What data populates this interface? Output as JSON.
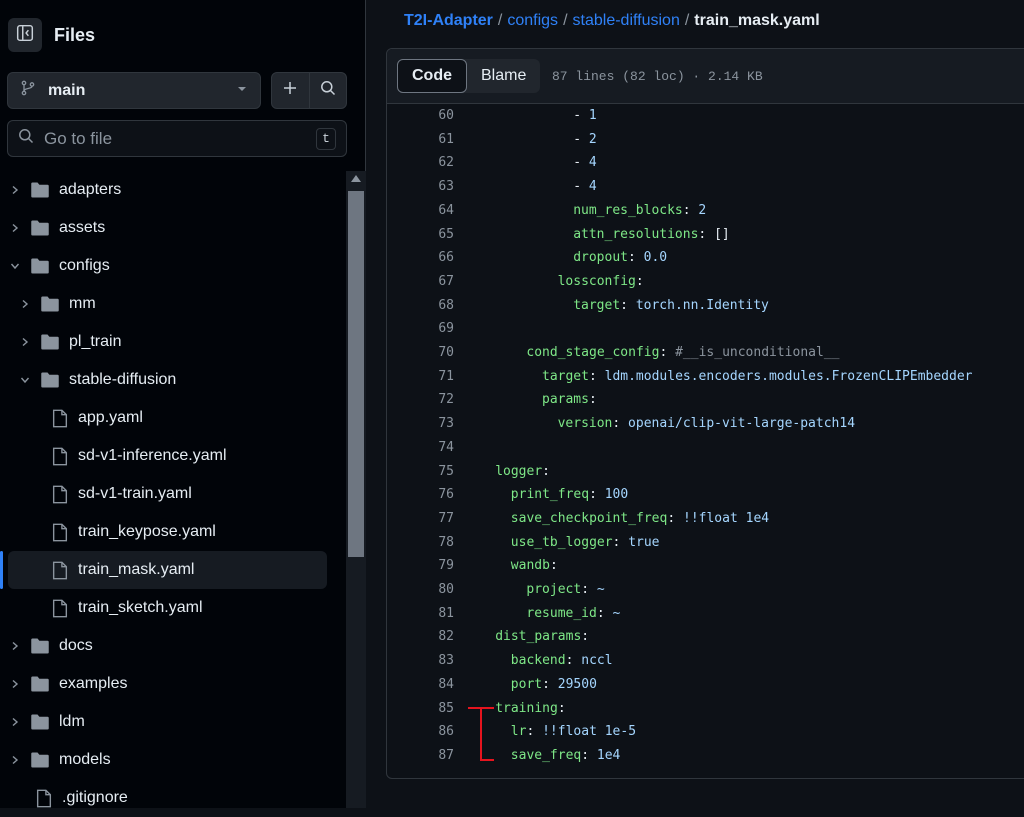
{
  "sidebar": {
    "title": "Files",
    "branch": "main",
    "search_placeholder": "Go to file",
    "search_shortcut": "t",
    "tree": [
      {
        "label": "adapters",
        "type": "folder",
        "depth": 0,
        "expanded": false
      },
      {
        "label": "assets",
        "type": "folder",
        "depth": 0,
        "expanded": false
      },
      {
        "label": "configs",
        "type": "folder",
        "depth": 0,
        "expanded": true
      },
      {
        "label": "mm",
        "type": "folder",
        "depth": 1,
        "expanded": false
      },
      {
        "label": "pl_train",
        "type": "folder",
        "depth": 1,
        "expanded": false
      },
      {
        "label": "stable-diffusion",
        "type": "folder",
        "depth": 1,
        "expanded": true
      },
      {
        "label": "app.yaml",
        "type": "file",
        "depth": 2
      },
      {
        "label": "sd-v1-inference.yaml",
        "type": "file",
        "depth": 2
      },
      {
        "label": "sd-v1-train.yaml",
        "type": "file",
        "depth": 2
      },
      {
        "label": "train_keypose.yaml",
        "type": "file",
        "depth": 2
      },
      {
        "label": "train_mask.yaml",
        "type": "file",
        "depth": 2,
        "selected": true
      },
      {
        "label": "train_sketch.yaml",
        "type": "file",
        "depth": 2
      },
      {
        "label": "docs",
        "type": "folder",
        "depth": 0,
        "expanded": false
      },
      {
        "label": "examples",
        "type": "folder",
        "depth": 0,
        "expanded": false
      },
      {
        "label": "ldm",
        "type": "folder",
        "depth": 0,
        "expanded": false
      },
      {
        "label": "models",
        "type": "folder",
        "depth": 0,
        "expanded": false
      },
      {
        "label": ".gitignore",
        "type": "file",
        "depth": 0
      }
    ]
  },
  "breadcrumb": {
    "repo": "T2I-Adapter",
    "sep": "/",
    "parts": [
      "configs",
      "stable-diffusion"
    ],
    "current": "train_mask.yaml"
  },
  "file_header": {
    "tabs": [
      "Code",
      "Blame"
    ],
    "active_tab": "Code",
    "meta": "87 lines (82 loc) · 2.14 KB"
  },
  "code_lines": [
    {
      "n": 60,
      "indent": 14,
      "seg": [
        [
          "p",
          "- "
        ],
        [
          "v",
          "1"
        ]
      ]
    },
    {
      "n": 61,
      "indent": 14,
      "seg": [
        [
          "p",
          "- "
        ],
        [
          "v",
          "2"
        ]
      ]
    },
    {
      "n": 62,
      "indent": 14,
      "seg": [
        [
          "p",
          "- "
        ],
        [
          "v",
          "4"
        ]
      ]
    },
    {
      "n": 63,
      "indent": 14,
      "seg": [
        [
          "p",
          "- "
        ],
        [
          "v",
          "4"
        ]
      ]
    },
    {
      "n": 64,
      "indent": 14,
      "seg": [
        [
          "k",
          "num_res_blocks"
        ],
        [
          "p",
          ": "
        ],
        [
          "v",
          "2"
        ]
      ]
    },
    {
      "n": 65,
      "indent": 14,
      "seg": [
        [
          "k",
          "attn_resolutions"
        ],
        [
          "p",
          ": []"
        ]
      ]
    },
    {
      "n": 66,
      "indent": 14,
      "seg": [
        [
          "k",
          "dropout"
        ],
        [
          "p",
          ": "
        ],
        [
          "v",
          "0.0"
        ]
      ]
    },
    {
      "n": 67,
      "indent": 12,
      "seg": [
        [
          "k",
          "lossconfig"
        ],
        [
          "p",
          ":"
        ]
      ]
    },
    {
      "n": 68,
      "indent": 14,
      "seg": [
        [
          "k",
          "target"
        ],
        [
          "p",
          ": "
        ],
        [
          "v",
          "torch.nn.Identity"
        ]
      ]
    },
    {
      "n": 69,
      "indent": 0,
      "seg": []
    },
    {
      "n": 70,
      "indent": 8,
      "seg": [
        [
          "k",
          "cond_stage_config"
        ],
        [
          "p",
          ": "
        ],
        [
          "c",
          "#__is_unconditional__"
        ]
      ]
    },
    {
      "n": 71,
      "indent": 10,
      "seg": [
        [
          "k",
          "target"
        ],
        [
          "p",
          ": "
        ],
        [
          "v",
          "ldm.modules.encoders.modules.FrozenCLIPEmbedder"
        ]
      ]
    },
    {
      "n": 72,
      "indent": 10,
      "seg": [
        [
          "k",
          "params"
        ],
        [
          "p",
          ":"
        ]
      ]
    },
    {
      "n": 73,
      "indent": 12,
      "seg": [
        [
          "k",
          "version"
        ],
        [
          "p",
          ": "
        ],
        [
          "v",
          "openai/clip-vit-large-patch14"
        ]
      ]
    },
    {
      "n": 74,
      "indent": 0,
      "seg": []
    },
    {
      "n": 75,
      "indent": 4,
      "seg": [
        [
          "k",
          "logger"
        ],
        [
          "p",
          ":"
        ]
      ]
    },
    {
      "n": 76,
      "indent": 6,
      "seg": [
        [
          "k",
          "print_freq"
        ],
        [
          "p",
          ": "
        ],
        [
          "v",
          "100"
        ]
      ]
    },
    {
      "n": 77,
      "indent": 6,
      "seg": [
        [
          "k",
          "save_checkpoint_freq"
        ],
        [
          "p",
          ": "
        ],
        [
          "v",
          "!!float 1e4"
        ]
      ]
    },
    {
      "n": 78,
      "indent": 6,
      "seg": [
        [
          "k",
          "use_tb_logger"
        ],
        [
          "p",
          ": "
        ],
        [
          "v",
          "true"
        ]
      ]
    },
    {
      "n": 79,
      "indent": 6,
      "seg": [
        [
          "k",
          "wandb"
        ],
        [
          "p",
          ":"
        ]
      ]
    },
    {
      "n": 80,
      "indent": 8,
      "seg": [
        [
          "k",
          "project"
        ],
        [
          "p",
          ": "
        ],
        [
          "v",
          "~"
        ]
      ]
    },
    {
      "n": 81,
      "indent": 8,
      "seg": [
        [
          "k",
          "resume_id"
        ],
        [
          "p",
          ": "
        ],
        [
          "v",
          "~"
        ]
      ]
    },
    {
      "n": 82,
      "indent": 4,
      "seg": [
        [
          "k",
          "dist_params"
        ],
        [
          "p",
          ":"
        ]
      ]
    },
    {
      "n": 83,
      "indent": 6,
      "seg": [
        [
          "k",
          "backend"
        ],
        [
          "p",
          ": "
        ],
        [
          "v",
          "nccl"
        ]
      ]
    },
    {
      "n": 84,
      "indent": 6,
      "seg": [
        [
          "k",
          "port"
        ],
        [
          "p",
          ": "
        ],
        [
          "v",
          "29500"
        ]
      ]
    },
    {
      "n": 85,
      "indent": 4,
      "seg": [
        [
          "k",
          "training"
        ],
        [
          "p",
          ":"
        ]
      ]
    },
    {
      "n": 86,
      "indent": 6,
      "seg": [
        [
          "k",
          "lr"
        ],
        [
          "p",
          ": "
        ],
        [
          "v",
          "!!float 1e-5"
        ]
      ]
    },
    {
      "n": 87,
      "indent": 6,
      "seg": [
        [
          "k",
          "save_freq"
        ],
        [
          "p",
          ": "
        ],
        [
          "v",
          "1e4"
        ]
      ]
    }
  ],
  "icons": {
    "sidebar_toggle": "sidebar-collapse-icon",
    "branch": "git-branch-icon",
    "dropdown": "caret-down-icon",
    "add": "plus-icon",
    "search": "search-icon",
    "folder": "folder-icon",
    "file": "file-icon"
  },
  "colors": {
    "accent": "#2f81f7",
    "annotation": "#e5141e",
    "key": "#7ee787",
    "value": "#a5d6ff"
  }
}
